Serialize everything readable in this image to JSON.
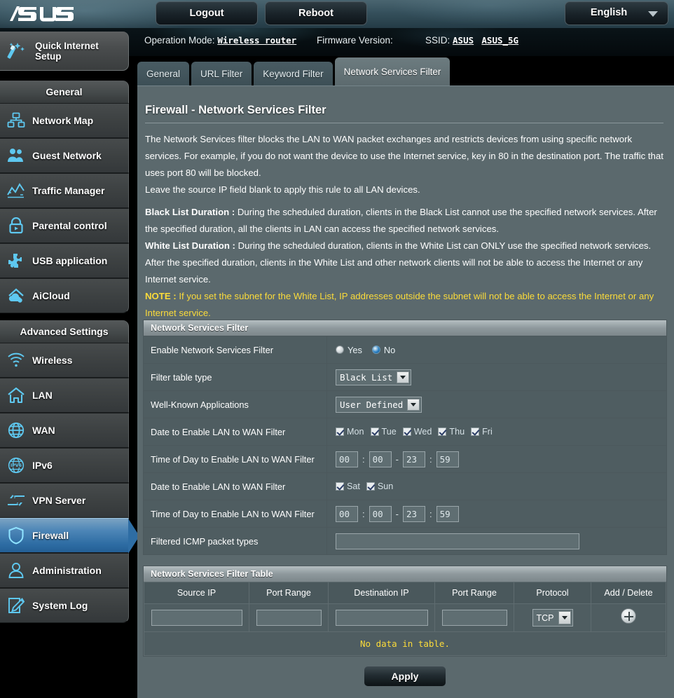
{
  "topbar": {
    "logo": "/ISUS",
    "logout_label": "Logout",
    "reboot_label": "Reboot",
    "language_label": "English",
    "language_arrow_icon": "chevron-down-icon"
  },
  "infobar": {
    "operation_mode_label": "Operation Mode:",
    "operation_mode_value": "Wireless router",
    "firmware_label": "Firmware Version:",
    "firmware_value": "",
    "ssid_label": "SSID:",
    "ssid_values": [
      "ASUS",
      "ASUS_5G"
    ],
    "status_icons": [
      "users-icon",
      "devices-icon",
      "usb-icon",
      "printer-icon"
    ]
  },
  "sidebar": {
    "quick_setup": {
      "label_line1": "Quick Internet",
      "label_line2": "Setup",
      "icon": "magic-wand-icon"
    },
    "groups": [
      {
        "title": "General",
        "items": [
          {
            "label": "Network Map",
            "icon": "network-map-icon",
            "active": false
          },
          {
            "label": "Guest Network",
            "icon": "guest-network-icon",
            "active": false
          },
          {
            "label": "Traffic Manager",
            "icon": "traffic-manager-icon",
            "active": false
          },
          {
            "label": "Parental control",
            "icon": "lock-icon",
            "active": false
          },
          {
            "label": "USB application",
            "icon": "puzzle-icon",
            "active": false
          },
          {
            "label": "AiCloud",
            "icon": "cloud-house-icon",
            "active": false
          }
        ]
      },
      {
        "title": "Advanced Settings",
        "items": [
          {
            "label": "Wireless",
            "icon": "wifi-icon",
            "active": false
          },
          {
            "label": "LAN",
            "icon": "house-icon",
            "active": false
          },
          {
            "label": "WAN",
            "icon": "globe-icon",
            "active": false
          },
          {
            "label": "IPv6",
            "icon": "ipv6-globe-icon",
            "active": false
          },
          {
            "label": "VPN Server",
            "icon": "vpn-arrows-icon",
            "active": false
          },
          {
            "label": "Firewall",
            "icon": "shield-icon",
            "active": true
          },
          {
            "label": "Administration",
            "icon": "user-icon",
            "active": false
          },
          {
            "label": "System Log",
            "icon": "pencil-note-icon",
            "active": false
          }
        ]
      }
    ]
  },
  "tabs": [
    {
      "label": "General",
      "active": false
    },
    {
      "label": "URL Filter",
      "active": false
    },
    {
      "label": "Keyword Filter",
      "active": false
    },
    {
      "label": "Network Services Filter",
      "active": true
    }
  ],
  "main": {
    "page_title": "Firewall - Network Services Filter",
    "intro_p1": "The Network Services filter blocks the LAN to WAN packet exchanges and restricts devices from using specific network services. For example, if you do not want the device to use the Internet service, key in 80 in the destination port. The traffic that uses port 80 will be blocked.",
    "intro_p2": "Leave the source IP field blank to apply this rule to all LAN devices.",
    "black_list_title": "Black List Duration :",
    "black_list_text": " During the scheduled duration, clients in the Black List cannot use the specified network services. After the specified duration, all the clients in LAN can access the specified network services.",
    "white_list_title": "White List Duration :",
    "white_list_text": " During the scheduled duration, clients in the White List can ONLY use the specified network services. After the specified duration, clients in the White List and other network clients will not be able to access the Internet or any Internet service.",
    "note_title": "NOTE :",
    "note_text": " If you set the subnet for the White List, IP addresses outside the subnet will not be able to access the Internet or any Internet service."
  },
  "filter_section": {
    "header": "Network Services Filter",
    "rows": {
      "enable": {
        "label": "Enable Network Services Filter",
        "yes_label": "Yes",
        "no_label": "No",
        "selected": "No"
      },
      "table_type": {
        "label": "Filter table type",
        "value": "Black List"
      },
      "well_known": {
        "label": "Well-Known Applications",
        "value": "User Defined"
      },
      "date_weekday": {
        "label": "Date to Enable LAN to WAN Filter",
        "days": [
          {
            "label": "Mon",
            "checked": true
          },
          {
            "label": "Tue",
            "checked": true
          },
          {
            "label": "Wed",
            "checked": true
          },
          {
            "label": "Thu",
            "checked": true
          },
          {
            "label": "Fri",
            "checked": true
          }
        ]
      },
      "time_weekday": {
        "label": "Time of Day to Enable LAN to WAN Filter",
        "start_hour": "00",
        "start_min": "00",
        "end_hour": "23",
        "end_min": "59",
        "colon": ":",
        "dash": "-"
      },
      "date_weekend": {
        "label": "Date to Enable LAN to WAN Filter",
        "days": [
          {
            "label": "Sat",
            "checked": true
          },
          {
            "label": "Sun",
            "checked": true
          }
        ]
      },
      "time_weekend": {
        "label": "Time of Day to Enable LAN to WAN Filter",
        "start_hour": "00",
        "start_min": "00",
        "end_hour": "23",
        "end_min": "59",
        "colon": ":",
        "dash": "-"
      },
      "icmp": {
        "label": "Filtered ICMP packet types",
        "value": ""
      }
    }
  },
  "filter_table": {
    "header": "Network Services Filter Table",
    "columns": [
      "Source IP",
      "Port Range",
      "Destination IP",
      "Port Range",
      "Protocol",
      "Add / Delete"
    ],
    "input_row": {
      "source_ip": "",
      "port_range_1": "",
      "destination_ip": "",
      "port_range_2": "",
      "protocol": "TCP",
      "add_icon": "plus-circle-icon"
    },
    "empty_message": "No data in table."
  },
  "footer": {
    "apply_label": "Apply"
  }
}
